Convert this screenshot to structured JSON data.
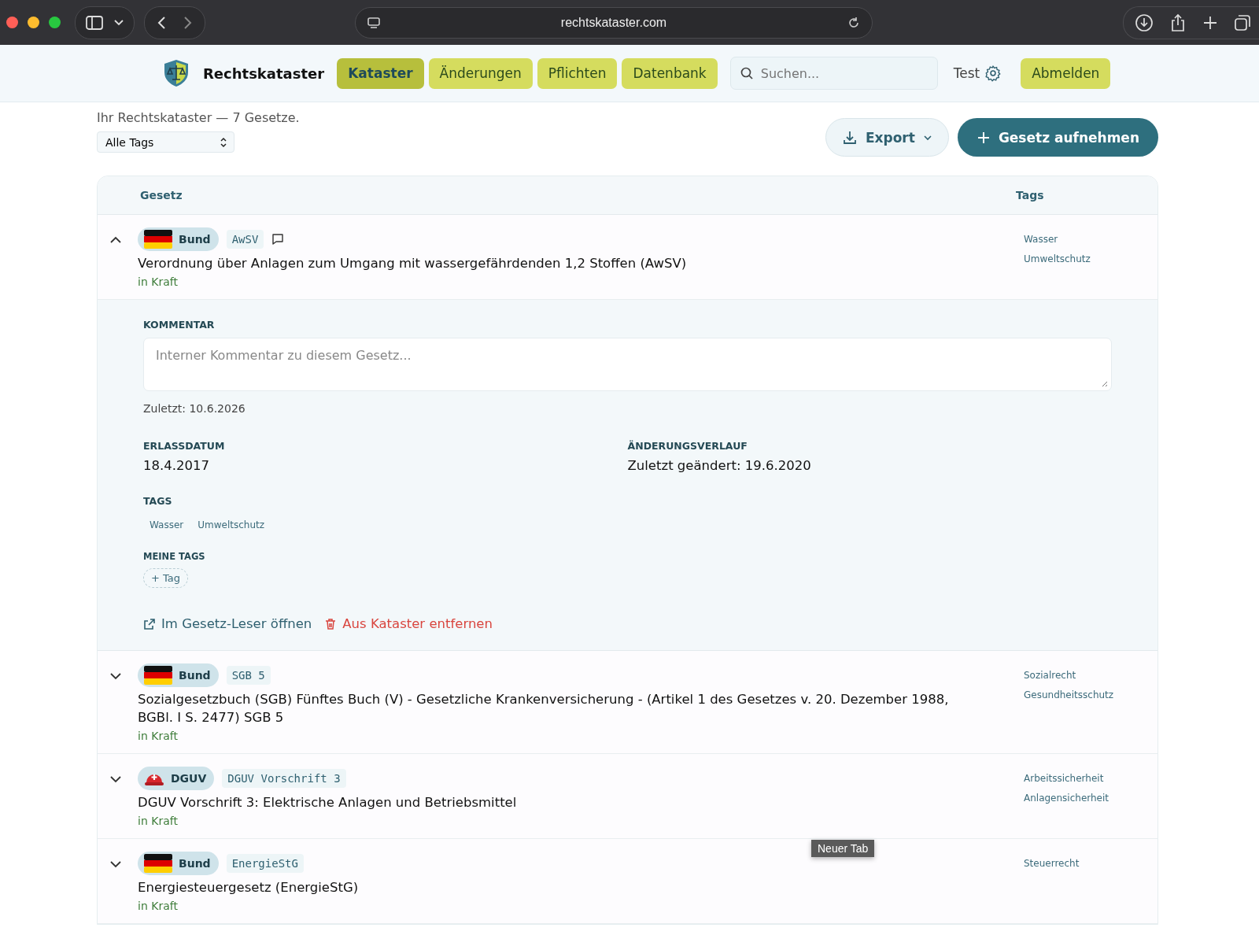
{
  "browser": {
    "url": "rechtskataster.com",
    "tooltip": "Neuer Tab"
  },
  "nav": {
    "brand": "Rechtskataster",
    "tabs": [
      {
        "label": "Kataster",
        "selected": true
      },
      {
        "label": "Änderungen",
        "selected": false
      },
      {
        "label": "Pflichten",
        "selected": false
      },
      {
        "label": "Datenbank",
        "selected": false
      }
    ],
    "search": {
      "placeholder": "Suchen..."
    },
    "user": "Test",
    "logout": "Abmelden"
  },
  "summary": {
    "text": "Ihr Rechtskataster — 7 Gesetze.",
    "tag_filter": "Alle Tags",
    "export": "Export",
    "add": "Gesetz aufnehmen"
  },
  "table": {
    "columns": [
      "Gesetz",
      "Tags"
    ],
    "rows": [
      {
        "expanded": true,
        "source": {
          "kind": "flag",
          "label": "Bund"
        },
        "abbr": "AwSV",
        "comment": true,
        "title": "Verordnung über Anlagen zum Umgang mit wassergefährdenden 1,2 Stoffen (AwSV)",
        "status": "in Kraft",
        "tags": [
          "Wasser",
          "Umweltschutz"
        ],
        "detail": {
          "comment_label": "KOMMENTAR",
          "comment_placeholder": "Interner Kommentar zu diesem Gesetz...",
          "last_saved": "Zuletzt: 10.6.2026",
          "fields": [
            {
              "label": "ERLASSDATUM",
              "value": "18.4.2017"
            },
            {
              "label": "ÄNDERUNGSVERLAUF",
              "value": "Zuletzt geändert: 19.6.2020"
            }
          ],
          "tags_label": "TAGS",
          "tags": [
            "Wasser",
            "Umweltschutz"
          ],
          "my_tags_label": "MEINE TAGS",
          "add_tag": "+ Tag",
          "actions": [
            {
              "kind": "open",
              "label": "Im Gesetz-Leser öffnen"
            },
            {
              "kind": "remove",
              "label": "Aus Kataster entfernen"
            }
          ]
        }
      },
      {
        "expanded": false,
        "source": {
          "kind": "flag",
          "label": "Bund"
        },
        "abbr": "SGB 5",
        "comment": false,
        "title": "Sozialgesetzbuch (SGB) Fünftes Buch (V) - Gesetzliche Krankenversicherung - (Artikel 1 des Gesetzes v. 20. Dezember 1988, BGBl. I S. 2477) SGB 5",
        "status": "in Kraft",
        "tags": [
          "Sozialrecht",
          "Gesundheitsschutz"
        ]
      },
      {
        "expanded": false,
        "source": {
          "kind": "helmet",
          "label": "DGUV"
        },
        "abbr": "DGUV Vorschrift 3",
        "comment": false,
        "title": "DGUV Vorschrift 3: Elektrische Anlagen und Betriebsmittel",
        "status": "in Kraft",
        "tags": [
          "Arbeitssicherheit",
          "Anlagensicherheit"
        ]
      },
      {
        "expanded": false,
        "source": {
          "kind": "flag",
          "label": "Bund"
        },
        "abbr": "EnergieStG",
        "comment": false,
        "title": "Energiesteuergesetz (EnergieStG)",
        "status": "in Kraft",
        "tags": [
          "Steuerrecht"
        ]
      }
    ]
  }
}
